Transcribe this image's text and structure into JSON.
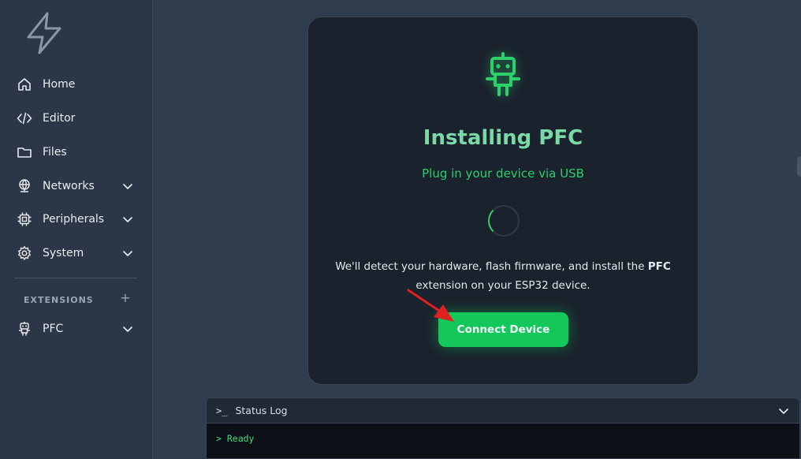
{
  "sidebar": {
    "items": [
      {
        "label": "Home",
        "icon": "home-icon",
        "expandable": false
      },
      {
        "label": "Editor",
        "icon": "code-icon",
        "expandable": false
      },
      {
        "label": "Files",
        "icon": "folder-icon",
        "expandable": false
      },
      {
        "label": "Networks",
        "icon": "network-icon",
        "expandable": true
      },
      {
        "label": "Peripherals",
        "icon": "chip-icon",
        "expandable": true
      },
      {
        "label": "System",
        "icon": "gear-icon",
        "expandable": true
      }
    ],
    "extensions_label": "EXTENSIONS",
    "extensions_add": "+",
    "extensions": [
      {
        "label": "PFC",
        "icon": "robot-icon",
        "expandable": true
      }
    ]
  },
  "card": {
    "title": "Installing PFC",
    "subtitle": "Plug in your device via USB",
    "description_pre": "We'll detect your hardware, flash firmware, and install the ",
    "description_bold": "PFC",
    "description_post": " extension on your ESP32 device.",
    "button_label": "Connect Device"
  },
  "status_log": {
    "prompt_icon": ">_",
    "title": "Status Log",
    "lines": [
      "> Ready"
    ]
  },
  "colors": {
    "accent": "#13c75a",
    "title": "#7ad9a6",
    "sidebar_bg": "#2b3646",
    "main_bg": "#303d4e",
    "card_bg": "#1a222d"
  }
}
